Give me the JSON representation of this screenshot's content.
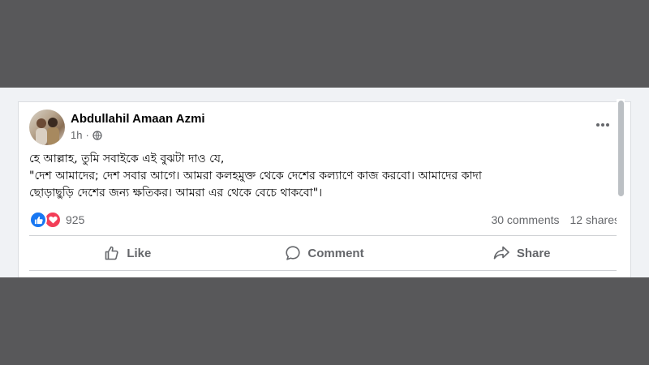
{
  "post": {
    "author": "Abdullahil Amaan Azmi",
    "time": "1h",
    "privacy_icon": "globe-icon",
    "text_lines": [
      "হে আল্লাহ, তুমি সবাইকে এই বুঝটা দাও যে,",
      "\"দেশ আমাদের; দেশ সবার আগে। আমরা কলহমুক্ত থেকে দেশের কল্যাণে কাজ করবো। আমাদের কাদা",
      "ছোড়াছুড়ি দেশের জন্য ক্ষতিকর। আমরা এর থেকে বেচে থাকবো\"।"
    ]
  },
  "reactions": {
    "icons": [
      "like-icon",
      "love-icon"
    ],
    "count": "925"
  },
  "stats": {
    "comments": "30 comments",
    "shares": "12 shares"
  },
  "actions": {
    "like": "Like",
    "comment": "Comment",
    "share": "Share"
  },
  "colors": {
    "background_dark": "#58585a",
    "card": "#ffffff",
    "secondary_text": "#65676b",
    "like_blue": "#1877f2",
    "love_red": "#f33e58"
  }
}
